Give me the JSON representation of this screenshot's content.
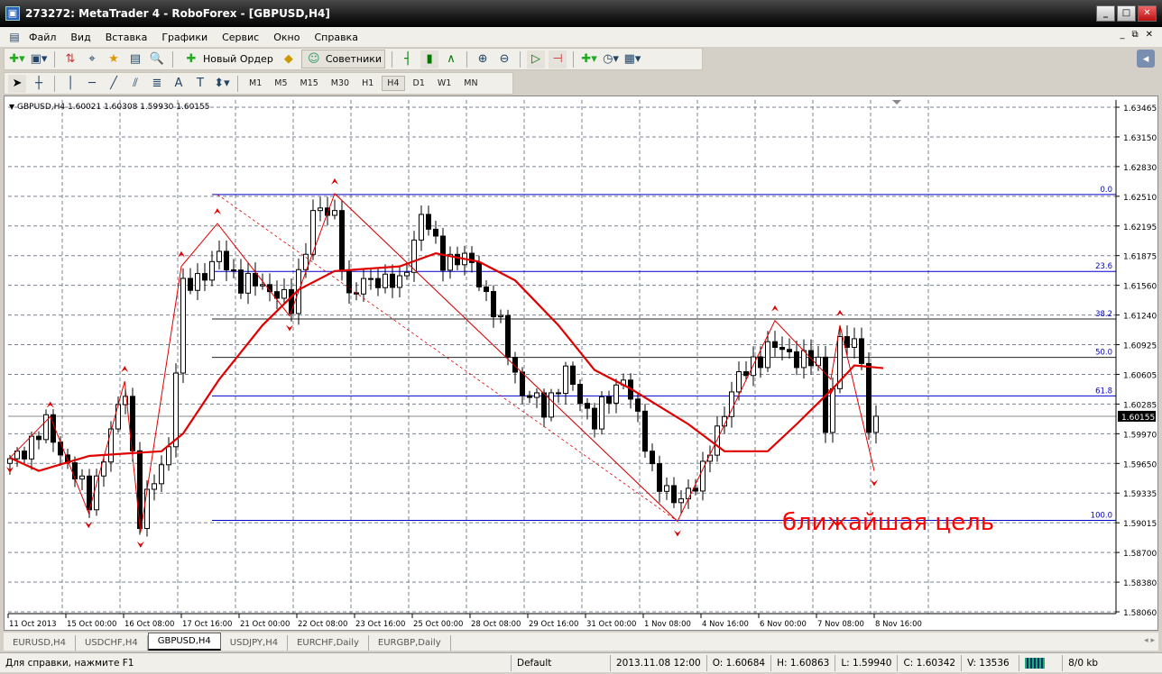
{
  "window": {
    "title": "273272: MetaTrader 4 - RoboForex - [GBPUSD,H4]"
  },
  "menu": [
    "Файл",
    "Вид",
    "Вставка",
    "Графики",
    "Сервис",
    "Окно",
    "Справка"
  ],
  "toolbar": {
    "new_order": "Новый Ордер",
    "experts": "Советники"
  },
  "timeframes": [
    "M1",
    "M5",
    "M15",
    "M30",
    "H1",
    "H4",
    "D1",
    "W1",
    "MN"
  ],
  "active_timeframe": "H4",
  "drawtools": {
    "text_tool": "A"
  },
  "chart": {
    "header": "GBPUSD,H4  1.60021 1.60308 1.59930 1.60155",
    "price_labels": [
      "1.63465",
      "1.63150",
      "1.62830",
      "1.62510",
      "1.62195",
      "1.61875",
      "1.61560",
      "1.61240",
      "1.60925",
      "1.60605",
      "1.60285",
      "1.59970",
      "1.59650",
      "1.59335",
      "1.59015",
      "1.58700",
      "1.58380",
      "1.58060"
    ],
    "current_price": "1.60155",
    "current_price_value": 1.60155,
    "date_labels": [
      "11 Oct 2013",
      "15 Oct 00:00",
      "16 Oct 08:00",
      "17 Oct 16:00",
      "21 Oct 00:00",
      "22 Oct 08:00",
      "23 Oct 16:00",
      "25 Oct 00:00",
      "28 Oct 08:00",
      "29 Oct 16:00",
      "31 Oct 00:00",
      "1 Nov 08:00",
      "4 Nov 16:00",
      "6 Nov 00:00",
      "7 Nov 08:00",
      "8 Nov 16:00"
    ],
    "annotation": "ближайшая цель",
    "colors": {
      "bull": "#ffffff",
      "bear": "#000000",
      "ma": "#e00000",
      "zigzag": "#e00000",
      "fib": "#0000cc",
      "annotation": "#ff0000"
    }
  },
  "chart_data": {
    "type": "candlestick",
    "symbol": "GBPUSD",
    "timeframe": "H4",
    "ylim": [
      1.5806,
      1.63465
    ],
    "bars": 121,
    "close_path": [
      [
        0,
        1.5965
      ],
      [
        5,
        1.6005
      ],
      [
        11,
        1.5925
      ],
      [
        16,
        1.6045
      ],
      [
        18,
        1.5905
      ],
      [
        22,
        1.5985
      ],
      [
        24,
        1.615
      ],
      [
        29,
        1.6185
      ],
      [
        32,
        1.616
      ],
      [
        37,
        1.615
      ],
      [
        39,
        1.613
      ],
      [
        42,
        1.6235
      ],
      [
        45,
        1.623
      ],
      [
        47,
        1.614
      ],
      [
        50,
        1.6165
      ],
      [
        54,
        1.6155
      ],
      [
        57,
        1.623
      ],
      [
        60,
        1.6185
      ],
      [
        64,
        1.618
      ],
      [
        68,
        1.611
      ],
      [
        71,
        1.604
      ],
      [
        74,
        1.6025
      ],
      [
        77,
        1.606
      ],
      [
        81,
        1.601
      ],
      [
        85,
        1.606
      ],
      [
        89,
        1.596
      ],
      [
        92,
        1.592
      ],
      [
        96,
        1.5955
      ],
      [
        100,
        1.6045
      ],
      [
        105,
        1.609
      ],
      [
        109,
        1.608
      ],
      [
        112,
        1.607
      ],
      [
        113,
        1.6005
      ],
      [
        115,
        1.6095
      ],
      [
        118,
        1.6085
      ],
      [
        119,
        1.5995
      ],
      [
        120,
        1.60155
      ]
    ],
    "moving_average": [
      [
        0,
        1.5971
      ],
      [
        4,
        1.5957
      ],
      [
        11,
        1.5973
      ],
      [
        21,
        1.5978
      ],
      [
        24,
        1.5997
      ],
      [
        29,
        1.6055
      ],
      [
        35,
        1.6113
      ],
      [
        40,
        1.6151
      ],
      [
        45,
        1.6171
      ],
      [
        54,
        1.6176
      ],
      [
        59,
        1.619
      ],
      [
        65,
        1.6181
      ],
      [
        70,
        1.6161
      ],
      [
        76,
        1.6113
      ],
      [
        81,
        1.6065
      ],
      [
        86,
        1.6045
      ],
      [
        94,
        1.6007
      ],
      [
        99,
        1.5978
      ],
      [
        105,
        1.5978
      ],
      [
        109,
        1.6007
      ],
      [
        114,
        1.6045
      ],
      [
        117,
        1.607
      ],
      [
        121,
        1.6067
      ]
    ],
    "zigzag": [
      [
        0,
        1.5971
      ],
      [
        5.6,
        1.6015
      ],
      [
        10.9,
        1.5912
      ],
      [
        15.9,
        1.6053
      ],
      [
        18.1,
        1.5891
      ],
      [
        23.75,
        1.6176
      ],
      [
        28.75,
        1.6222
      ],
      [
        38.75,
        1.6123
      ],
      [
        45,
        1.6254
      ],
      [
        92.5,
        1.5903
      ],
      [
        106,
        1.6118
      ],
      [
        113.75,
        1.6055
      ],
      [
        115,
        1.6113
      ],
      [
        119.75,
        1.5957
      ]
    ],
    "fibonacci": {
      "high": 1.6253,
      "low": 1.5904,
      "start_bar": 28,
      "levels": [
        {
          "label": "0.0",
          "ratio": 0
        },
        {
          "label": "23.6",
          "ratio": 0.236
        },
        {
          "label": "38.2",
          "ratio": 0.382
        },
        {
          "label": "50.0",
          "ratio": 0.5
        },
        {
          "label": "61.8",
          "ratio": 0.618
        },
        {
          "label": "100.0",
          "ratio": 1
        }
      ]
    }
  },
  "tabs": [
    {
      "label": "EURUSD,H4"
    },
    {
      "label": "USDCHF,H4"
    },
    {
      "label": "GBPUSD,H4",
      "active": true
    },
    {
      "label": "USDJPY,H4"
    },
    {
      "label": "EURCHF,Daily"
    },
    {
      "label": "EURGBP,Daily"
    }
  ],
  "status": {
    "help": "Для справки, нажмите F1",
    "profile": "Default",
    "datetime": "2013.11.08 12:00",
    "open": "O: 1.60684",
    "high": "H: 1.60863",
    "low": "L: 1.59940",
    "close": "C: 1.60342",
    "volume": "V: 13536",
    "traffic": "8/0 kb"
  }
}
